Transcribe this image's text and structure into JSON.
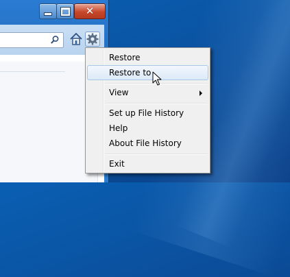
{
  "menu": {
    "items": [
      {
        "label": "Restore"
      },
      {
        "label": "Restore to"
      },
      {
        "label": "View"
      },
      {
        "label": "Set up File History"
      },
      {
        "label": "Help"
      },
      {
        "label": "About File History"
      },
      {
        "label": "Exit"
      }
    ],
    "highlighted": "Restore to"
  },
  "window": {
    "minimize_icon": "minimize-icon",
    "maximize_icon": "maximize-icon",
    "close_icon": "close-icon"
  },
  "icons": {
    "search": "search-icon",
    "home": "home-icon",
    "settings": "gear-icon",
    "submenu": "chevron-right-icon",
    "cursor": "mouse-cursor-icon"
  },
  "colors": {
    "desktop": "#0b4f9c",
    "menu_background": "#f0f0f0",
    "menu_highlight_border": "#a8c8ea",
    "close_button": "#c7462a"
  }
}
